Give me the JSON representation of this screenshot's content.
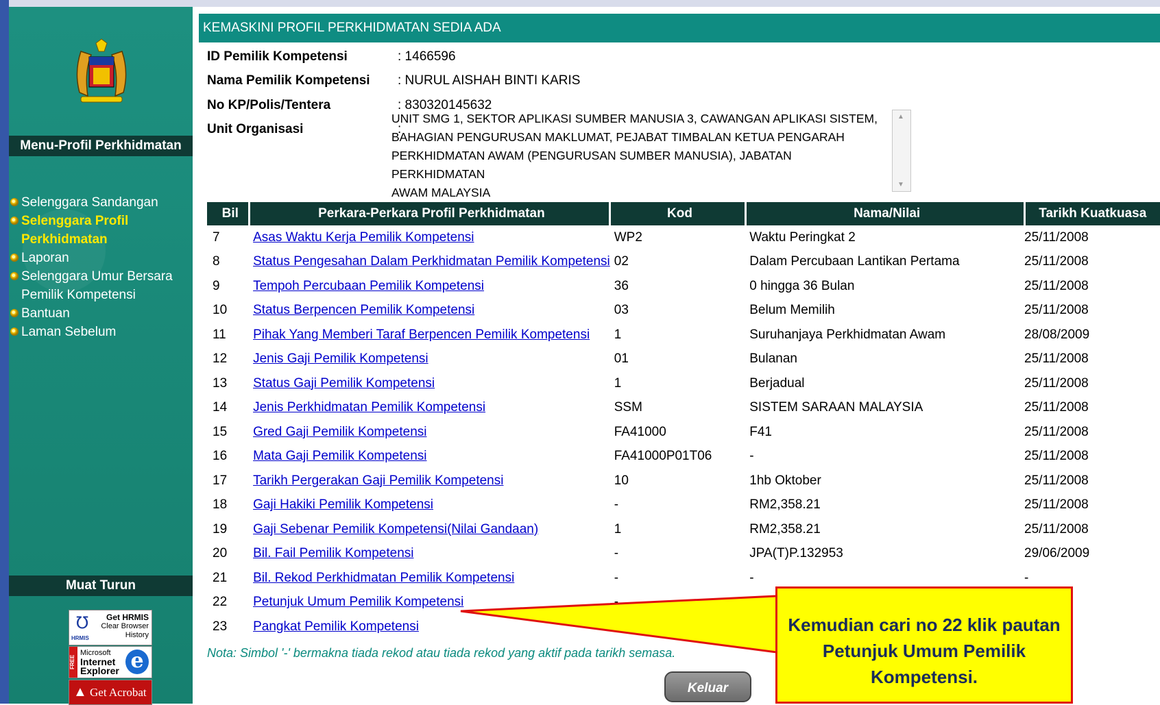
{
  "sidebar": {
    "menu_header": "Menu-Profil Perkhidmatan",
    "menu_items": [
      {
        "label": "Selenggara Sandangan",
        "active": false
      },
      {
        "label": "Selenggara Profil Perkhidmatan",
        "active": true
      },
      {
        "label": "Laporan",
        "active": false
      },
      {
        "label": "Selenggara Umur Bersara Pemilik Kompetensi",
        "active": false
      },
      {
        "label": "Bantuan",
        "active": false
      },
      {
        "label": "Laman Sebelum",
        "active": false
      }
    ],
    "download_header": "Muat Turun",
    "downloads": [
      {
        "line1": "Get HRMIS",
        "line2": "Clear Browser",
        "line3": "History",
        "tag": "HRMIS"
      },
      {
        "line1": "Microsoft",
        "line2": "Internet",
        "line3": "Explorer",
        "tag": "FREE"
      },
      {
        "line1": "Get Acrobat",
        "line2": "",
        "line3": "",
        "tag": ""
      }
    ]
  },
  "page_title": "KEMASKINI PROFIL PERKHIDMATAN SEDIA ADA",
  "info": {
    "id_label": "ID Pemilik Kompetensi",
    "id_value": ":  1466596",
    "name_label": "Nama Pemilik Kompetensi",
    "name_value": ":  NURUL AISHAH BINTI KARIS",
    "kp_label": "No KP/Polis/Tentera",
    "kp_value": ":  830320145632",
    "unit_label": "Unit Organisasi",
    "unit_sep": ":",
    "unit_lines": [
      "UNIT SMG 1, SEKTOR APLIKASI SUMBER MANUSIA 3, CAWANGAN APLIKASI SISTEM,",
      "BAHAGIAN PENGURUSAN MAKLUMAT, PEJABAT TIMBALAN KETUA PENGARAH",
      "PERKHIDMATAN AWAM (PENGURUSAN SUMBER MANUSIA), JABATAN PERKHIDMATAN",
      "AWAM MALAYSIA"
    ]
  },
  "table": {
    "headers": [
      "Bil",
      "Perkara-Perkara Profil Perkhidmatan",
      "Kod",
      "Nama/Nilai",
      "Tarikh Kuatkuasa"
    ],
    "rows": [
      [
        "7",
        "Asas Waktu Kerja Pemilik Kompetensi",
        "WP2",
        "Waktu Peringkat 2",
        "25/11/2008"
      ],
      [
        "8",
        "Status Pengesahan Dalam Perkhidmatan Pemilik Kompetensi",
        "02",
        "Dalam Percubaan Lantikan Pertama",
        "25/11/2008"
      ],
      [
        "9",
        "Tempoh Percubaan Pemilik Kompetensi",
        "36",
        "0 hingga 36 Bulan",
        "25/11/2008"
      ],
      [
        "10",
        "Status Berpencen Pemilik Kompetensi",
        "03",
        "Belum Memilih",
        "25/11/2008"
      ],
      [
        "11",
        "Pihak Yang Memberi Taraf Berpencen Pemilik Kompetensi",
        "1",
        "Suruhanjaya Perkhidmatan Awam",
        "28/08/2009"
      ],
      [
        "12",
        "Jenis Gaji Pemilik Kompetensi",
        "01",
        "Bulanan",
        "25/11/2008"
      ],
      [
        "13",
        "Status Gaji Pemilik Kompetensi",
        "1",
        "Berjadual",
        "25/11/2008"
      ],
      [
        "14",
        "Jenis Perkhidmatan Pemilik Kompetensi",
        "SSM",
        "SISTEM SARAAN MALAYSIA",
        "25/11/2008"
      ],
      [
        "15",
        "Gred Gaji Pemilik Kompetensi",
        "FA41000",
        "F41",
        "25/11/2008"
      ],
      [
        "16",
        "Mata Gaji Pemilik Kompetensi",
        "FA41000P01T06",
        "-",
        "25/11/2008"
      ],
      [
        "17",
        "Tarikh Pergerakan Gaji Pemilik Kompetensi",
        "10",
        "1hb Oktober",
        "25/11/2008"
      ],
      [
        "18",
        "Gaji Hakiki Pemilik Kompetensi",
        "-",
        "RM2,358.21",
        "25/11/2008"
      ],
      [
        "19",
        "Gaji Sebenar Pemilik Kompetensi(Nilai Gandaan)",
        "1",
        "RM2,358.21",
        "25/11/2008"
      ],
      [
        "20",
        "Bil. Fail Pemilik Kompetensi",
        "-",
        "JPA(T)P.132953",
        "29/06/2009"
      ],
      [
        "21",
        "Bil. Rekod Perkhidmatan Pemilik Kompetensi",
        "-",
        "-",
        "-"
      ],
      [
        "22",
        "Petunjuk Umum Pemilik Kompetensi",
        "-",
        "-",
        ""
      ],
      [
        "23",
        "Pangkat Pemilik Kompetensi",
        "",
        "",
        ""
      ]
    ]
  },
  "note": "Nota: Simbol '-' bermakna tiada rekod atau tiada rekod yang aktif pada tarikh semasa.",
  "keluar_label": "Keluar",
  "callout_text": "Kemudian cari no 22 klik pautan Petunjuk Umum Pemilik Kompetensi.",
  "colors": {
    "sidebar": "#1a8a7a",
    "header_dark": "#0f3a34",
    "title_bar": "#0f8c82",
    "link": "#0000cc",
    "callout_bg": "#ffff00",
    "callout_border": "#e01010"
  }
}
